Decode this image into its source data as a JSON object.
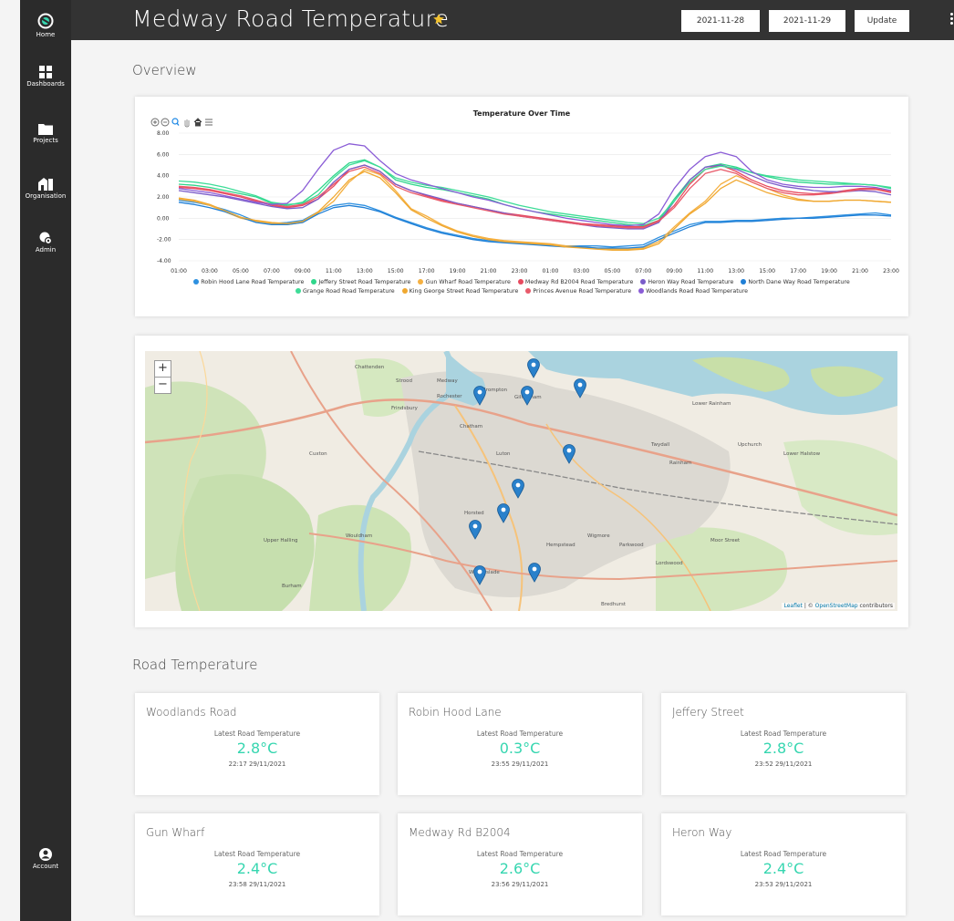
{
  "app": {
    "title": "Medway Road Temperature",
    "accent_color": "#36d6b0",
    "star_color": "#f2c12e"
  },
  "sidebar": {
    "items": [
      {
        "label": "Home",
        "icon": "logo-icon"
      },
      {
        "label": "Dashboards",
        "icon": "dashboard-icon"
      },
      {
        "label": "Projects",
        "icon": "folder-icon"
      },
      {
        "label": "Organisation",
        "icon": "building-icon"
      },
      {
        "label": "Admin",
        "icon": "admin-icon"
      },
      {
        "label": "Account",
        "icon": "user-icon"
      }
    ]
  },
  "header": {
    "start_date": "2021-11-28",
    "end_date": "2021-11-29",
    "update_label": "Update"
  },
  "overview": {
    "title": "Overview"
  },
  "chart_data": {
    "type": "line",
    "title": "Temperature Over Time",
    "xlabel": "",
    "ylabel": "",
    "ylim": [
      -4,
      8
    ],
    "yticks": [
      "-4.00",
      "-2.00",
      "0.00",
      "2.00",
      "4.00",
      "6.00",
      "8.00"
    ],
    "x": [
      "01:00",
      "02:00",
      "03:00",
      "04:00",
      "05:00",
      "06:00",
      "07:00",
      "08:00",
      "09:00",
      "10:00",
      "11:00",
      "12:00",
      "13:00",
      "14:00",
      "15:00",
      "16:00",
      "17:00",
      "18:00",
      "19:00",
      "20:00",
      "21:00",
      "22:00",
      "23:00",
      "00:00",
      "01:00",
      "02:00",
      "03:00",
      "04:00",
      "05:00",
      "06:00",
      "07:00",
      "08:00",
      "09:00",
      "10:00",
      "11:00",
      "12:00",
      "13:00",
      "14:00",
      "15:00",
      "16:00",
      "17:00",
      "18:00",
      "19:00",
      "20:00",
      "21:00",
      "22:00",
      "23:00"
    ],
    "xticks": [
      "01:00",
      "03:00",
      "05:00",
      "07:00",
      "09:00",
      "11:00",
      "13:00",
      "15:00",
      "17:00",
      "19:00",
      "21:00",
      "23:00",
      "01:00",
      "03:00",
      "05:00",
      "07:00",
      "09:00",
      "11:00",
      "13:00",
      "15:00",
      "17:00",
      "19:00",
      "21:00",
      "23:00"
    ],
    "grid": true,
    "legend_position": "bottom",
    "series": [
      {
        "name": "Robin Hood Lane Road Temperature",
        "color": "#2e90e0",
        "values": [
          1.7,
          1.5,
          1.2,
          0.8,
          0.3,
          -0.3,
          -0.5,
          -0.4,
          -0.2,
          0.6,
          1.2,
          1.4,
          1.2,
          0.7,
          0.1,
          -0.4,
          -0.9,
          -1.3,
          -1.6,
          -1.9,
          -2.1,
          -2.2,
          -2.3,
          -2.4,
          -2.5,
          -2.6,
          -2.6,
          -2.6,
          -2.7,
          -2.6,
          -2.5,
          -1.8,
          -1.2,
          -0.6,
          -0.3,
          -0.3,
          -0.2,
          -0.2,
          -0.1,
          0,
          0,
          0.1,
          0.2,
          0.3,
          0.4,
          0.5,
          0.3
        ]
      },
      {
        "name": "Jeffery Street Road Temperature",
        "color": "#2fd68b",
        "values": [
          3.2,
          3.1,
          2.9,
          2.6,
          2.3,
          2.0,
          1.4,
          1.2,
          1.5,
          2.6,
          4.0,
          5.2,
          5.5,
          4.8,
          3.6,
          3.2,
          2.9,
          2.7,
          2.4,
          2.1,
          1.8,
          1.3,
          0.9,
          0.6,
          0.4,
          0.2,
          0,
          -0.2,
          -0.4,
          -0.6,
          -0.7,
          -0.2,
          1.8,
          3.6,
          4.8,
          5.1,
          4.8,
          4.3,
          3.9,
          3.6,
          3.4,
          3.3,
          3.2,
          3.2,
          3.2,
          3.1,
          2.8
        ]
      },
      {
        "name": "Gun Wharf Road Temperature",
        "color": "#f5b041",
        "values": [
          1.8,
          1.6,
          1.2,
          0.6,
          0,
          -0.3,
          -0.5,
          -0.6,
          -0.4,
          0.5,
          1.6,
          3.4,
          4.6,
          4.1,
          2.6,
          0.9,
          0.2,
          -0.6,
          -1.2,
          -1.6,
          -1.9,
          -2.1,
          -2.2,
          -2.3,
          -2.4,
          -2.6,
          -2.7,
          -2.8,
          -2.9,
          -2.9,
          -2.8,
          -2.2,
          -0.8,
          0.5,
          1.6,
          3.2,
          4.0,
          3.4,
          2.8,
          2.2,
          1.8,
          1.6,
          1.6,
          1.7,
          1.7,
          1.6,
          1.5
        ]
      },
      {
        "name": "Medway Rd B2004 Road Temperature",
        "color": "#e84a5f",
        "values": [
          2.9,
          2.8,
          2.6,
          2.3,
          2.0,
          1.6,
          1.2,
          1.0,
          1.2,
          1.8,
          3.0,
          4.6,
          5.0,
          4.4,
          3.2,
          2.6,
          2.1,
          1.7,
          1.4,
          1.1,
          0.8,
          0.5,
          0.3,
          0.1,
          -0.1,
          -0.3,
          -0.5,
          -0.6,
          -0.7,
          -0.8,
          -0.8,
          -0.2,
          1.2,
          3.2,
          4.6,
          5.0,
          4.4,
          3.6,
          3.0,
          2.6,
          2.4,
          2.3,
          2.4,
          2.6,
          2.8,
          2.8,
          2.5
        ]
      },
      {
        "name": "Heron Way Road Temperature",
        "color": "#7a5cc9",
        "values": [
          2.6,
          2.4,
          2.2,
          2.0,
          1.7,
          1.4,
          1.1,
          0.9,
          1.0,
          1.8,
          3.4,
          4.6,
          5.0,
          4.4,
          3.2,
          2.6,
          2.2,
          1.8,
          1.4,
          1.1,
          0.8,
          0.5,
          0.2,
          0,
          -0.2,
          -0.4,
          -0.6,
          -0.8,
          -0.9,
          -1.0,
          -1.0,
          -0.4,
          1.6,
          3.6,
          4.8,
          5.0,
          4.6,
          4.0,
          3.4,
          3.0,
          2.8,
          2.6,
          2.5,
          2.5,
          2.6,
          2.5,
          2.2
        ]
      },
      {
        "name": "North Dane Way Road Temperature",
        "color": "#1f7fd6",
        "values": [
          1.5,
          1.3,
          1.0,
          0.6,
          0.1,
          -0.4,
          -0.6,
          -0.6,
          -0.4,
          0.4,
          1.0,
          1.2,
          1.0,
          0.6,
          0,
          -0.5,
          -1.0,
          -1.4,
          -1.7,
          -2.0,
          -2.2,
          -2.3,
          -2.4,
          -2.5,
          -2.6,
          -2.7,
          -2.7,
          -2.8,
          -2.8,
          -2.8,
          -2.7,
          -2.0,
          -1.4,
          -0.8,
          -0.4,
          -0.4,
          -0.3,
          -0.3,
          -0.2,
          -0.1,
          0,
          0,
          0.1,
          0.2,
          0.3,
          0.3,
          0.2
        ]
      },
      {
        "name": "Grange Road Road Temperature",
        "color": "#3ddc97",
        "values": [
          3.5,
          3.4,
          3.2,
          2.9,
          2.5,
          2.1,
          1.5,
          1.3,
          1.4,
          2.2,
          3.8,
          5.0,
          5.4,
          4.8,
          3.8,
          3.4,
          3.1,
          2.9,
          2.6,
          2.3,
          2.0,
          1.6,
          1.2,
          0.9,
          0.6,
          0.4,
          0.2,
          0,
          -0.2,
          -0.4,
          -0.5,
          0,
          1.6,
          3.4,
          4.6,
          4.9,
          4.7,
          4.3,
          4.0,
          3.8,
          3.6,
          3.5,
          3.4,
          3.3,
          3.2,
          3.1,
          2.9
        ]
      },
      {
        "name": "King George Street Road Temperature",
        "color": "#f0a830",
        "values": [
          1.9,
          1.7,
          1.3,
          0.7,
          0.1,
          -0.2,
          -0.4,
          -0.5,
          -0.3,
          0.6,
          2.0,
          3.6,
          4.4,
          3.8,
          2.4,
          0.8,
          0,
          -0.7,
          -1.3,
          -1.7,
          -2.0,
          -2.2,
          -2.3,
          -2.4,
          -2.5,
          -2.7,
          -2.8,
          -2.9,
          -3.0,
          -3.0,
          -2.9,
          -2.4,
          -1.0,
          0.4,
          1.4,
          2.8,
          3.6,
          3.0,
          2.4,
          2.0,
          1.7,
          1.6,
          1.6,
          1.7,
          1.7,
          1.6,
          1.5
        ]
      },
      {
        "name": "Princes Avenue Road Temperature",
        "color": "#e85a6a",
        "values": [
          3.0,
          2.9,
          2.7,
          2.4,
          2.1,
          1.7,
          1.3,
          1.1,
          1.3,
          2.0,
          3.2,
          4.4,
          4.8,
          4.2,
          3.0,
          2.4,
          2.0,
          1.6,
          1.3,
          1.0,
          0.7,
          0.4,
          0.2,
          0,
          -0.2,
          -0.4,
          -0.6,
          -0.7,
          -0.8,
          -0.9,
          -0.9,
          -0.3,
          1.0,
          2.8,
          4.2,
          4.6,
          4.2,
          3.4,
          2.8,
          2.4,
          2.2,
          2.2,
          2.3,
          2.5,
          2.7,
          2.7,
          2.4
        ]
      },
      {
        "name": "Woodlands Road Road Temperature",
        "color": "#8a5cd6",
        "values": [
          2.8,
          2.6,
          2.4,
          2.1,
          1.8,
          1.5,
          1.3,
          1.4,
          2.6,
          4.6,
          6.4,
          7.0,
          6.8,
          5.4,
          4.2,
          3.6,
          3.2,
          2.8,
          2.4,
          2.0,
          1.7,
          1.3,
          0.9,
          0.6,
          0.3,
          0,
          -0.2,
          -0.4,
          -0.6,
          -0.7,
          -0.6,
          0.4,
          2.8,
          4.6,
          5.8,
          6.2,
          5.8,
          4.4,
          3.6,
          3.2,
          3.0,
          2.9,
          2.9,
          3.0,
          3.0,
          2.9,
          2.6
        ]
      }
    ]
  },
  "map": {
    "zoom_in": "+",
    "zoom_out": "−",
    "attribution_leaflet": "Leaflet",
    "attribution_osm": "OpenStreetMap",
    "attribution_suffix": "contributors",
    "labels": [
      "Strood",
      "Rochester",
      "Chatham",
      "Gillingham",
      "Brompton",
      "Luton",
      "Walderslade",
      "Lower Rainham",
      "Rainham",
      "Twydall",
      "Hempstead",
      "Wigmore",
      "Parkwood",
      "Lordswood",
      "Upchurch",
      "Lower Halstow",
      "Bredhurst",
      "Cuxton",
      "Upper Halling",
      "Burham",
      "Wouldham",
      "Horsted",
      "Moor Street",
      "Chattenden",
      "Frindsbury",
      "Medway"
    ]
  },
  "road_temperature": {
    "title": "Road Temperature",
    "label": "Latest Road Temperature",
    "cards": [
      {
        "name": "Woodlands Road",
        "value": "2.8°C",
        "time": "22:17 29/11/2021"
      },
      {
        "name": "Robin Hood Lane",
        "value": "0.3°C",
        "time": "23:55 29/11/2021"
      },
      {
        "name": "Jeffery Street",
        "value": "2.8°C",
        "time": "23:52 29/11/2021"
      },
      {
        "name": "Gun Wharf",
        "value": "2.4°C",
        "time": "23:58 29/11/2021"
      },
      {
        "name": "Medway Rd B2004",
        "value": "2.6°C",
        "time": "23:56 29/11/2021"
      },
      {
        "name": "Heron Way",
        "value": "2.4°C",
        "time": "23:53 29/11/2021"
      }
    ]
  }
}
